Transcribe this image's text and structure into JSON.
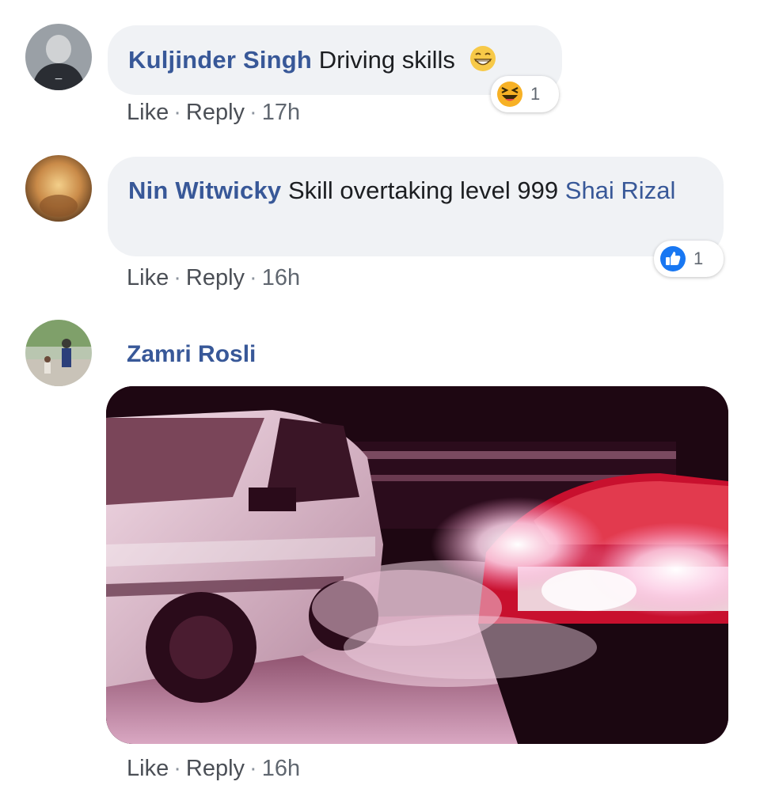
{
  "comments": [
    {
      "author": "Kuljinder Singh",
      "text": "Driving skills",
      "emoji": "grinning-face-icon",
      "actions": {
        "like": "Like",
        "reply": "Reply",
        "time": "17h",
        "sep": "·"
      },
      "reaction": {
        "type": "haha-icon",
        "count": "1"
      }
    },
    {
      "author": "Nin Witwicky",
      "text": "Skill overtaking level 999",
      "mention": "Shai Rizal",
      "actions": {
        "like": "Like",
        "reply": "Reply",
        "time": "16h",
        "sep": "·"
      },
      "reaction": {
        "type": "like-icon",
        "count": "1"
      }
    },
    {
      "author": "Zamri Rosli",
      "attachment": "gif-image",
      "actions": {
        "like": "Like",
        "reply": "Reply",
        "time": "16h",
        "sep": "·"
      }
    }
  ],
  "colors": {
    "author": "#385898",
    "bubble": "#f0f2f5",
    "meta": "#606770",
    "like_blue": "#1877f2",
    "haha_yellow": "#f7b125"
  }
}
